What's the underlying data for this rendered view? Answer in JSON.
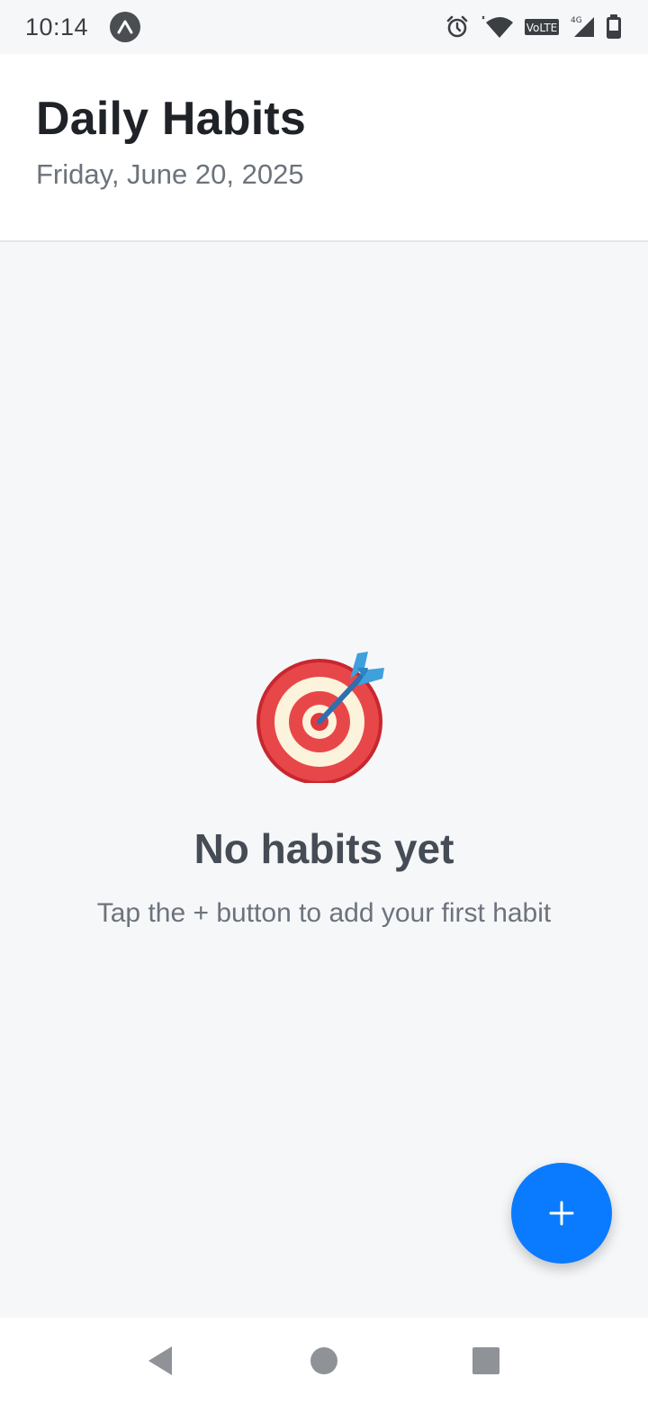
{
  "status_bar": {
    "time": "10:14",
    "icons": [
      "expo-icon",
      "alarm-icon",
      "wifi-icon",
      "volte-icon",
      "signal-4g-icon",
      "battery-icon"
    ]
  },
  "header": {
    "title": "Daily Habits",
    "date": "Friday, June 20, 2025"
  },
  "empty_state": {
    "icon": "direct-hit-target-icon",
    "title": "No habits yet",
    "subtitle": "Tap the + button to add your first habit"
  },
  "fab": {
    "label": "+",
    "color": "#0a7bff"
  },
  "nav_bar": {
    "buttons": [
      "back-icon",
      "home-icon",
      "recents-icon"
    ]
  },
  "colors": {
    "background": "#f6f7f9",
    "header_bg": "#ffffff",
    "title_text": "#1f2328",
    "muted_text": "#6c737c",
    "accent": "#0a7bff"
  }
}
